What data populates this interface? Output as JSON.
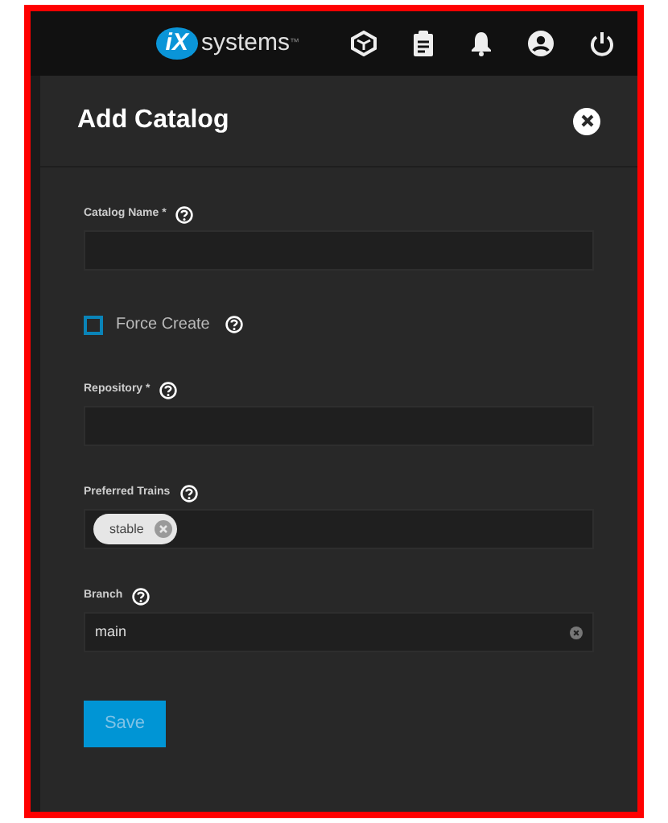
{
  "topbar": {
    "logo_mark": "iX",
    "logo_text": "systems",
    "logo_tm": "™"
  },
  "dialog": {
    "title": "Add Catalog",
    "fields": [
      {
        "kind": "text",
        "label": "Catalog Name *"
      },
      {
        "kind": "checkbox",
        "label": "Force Create",
        "checked": false
      },
      {
        "kind": "text",
        "label": "Repository *"
      },
      {
        "kind": "chips",
        "label": "Preferred Trains",
        "chips": [
          "stable"
        ]
      },
      {
        "kind": "text",
        "label": "Branch",
        "value": "main"
      }
    ],
    "save_button": {
      "label": "Save",
      "disabled": true
    }
  }
}
